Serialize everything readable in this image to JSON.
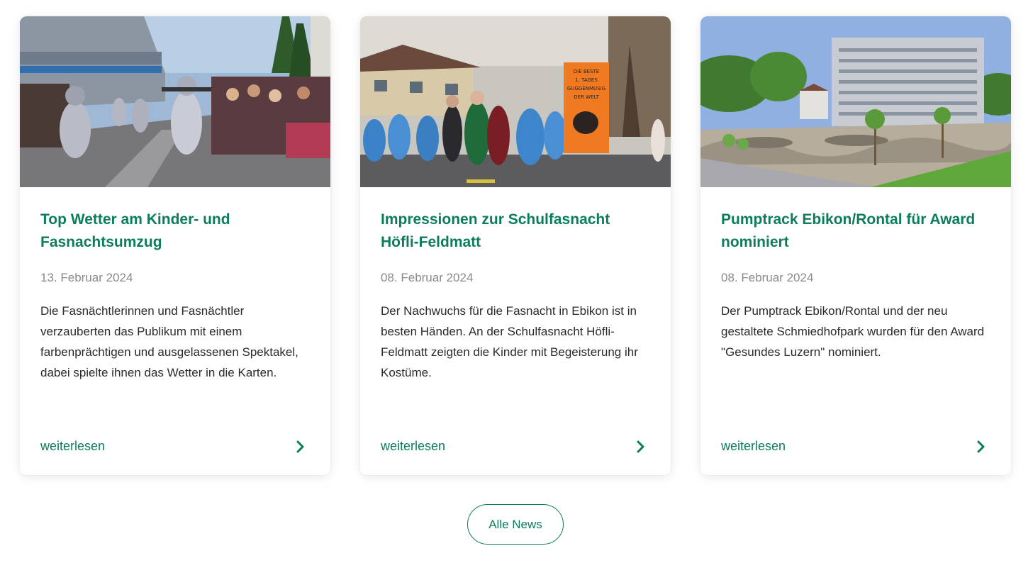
{
  "news": [
    {
      "title": "Top Wetter am Kinder- und Fasnachtsumzug",
      "date": "13. Februar 2024",
      "text": "Die Fasnächtlerinnen und Fasnächtler verzauberten das Publikum mit einem farbenprächtigen und ausgelassenen Spektakel, dabei spielte ihnen das Wetter in die Karten.",
      "link_label": "weiterlesen",
      "image": "carnival-parade-photo"
    },
    {
      "title": "Impressionen zur Schulfasnacht Höfli-Feldmatt",
      "date": "08. Februar 2024",
      "text": "Der Nachwuchs für die Fasnacht in Ebikon ist in besten Händen. An der Schulfasnacht Höfli-Feldmatt zeigten die Kinder mit Begeisterung ihr Kostüme.",
      "link_label": "weiterlesen",
      "image": "school-carnival-photo",
      "banner_lines": [
        "DIE BESTE",
        "1. TAGES",
        "GUGGENMUSIG",
        "DER WELT"
      ]
    },
    {
      "title": "Pumptrack Ebikon/Rontal für Award nominiert",
      "date": "08. Februar 2024",
      "text": "Der Pumptrack Ebikon/Rontal und der neu gestaltete Schmiedhofpark wurden für den Award \"Gesundes Luzern\" nominiert.",
      "link_label": "weiterlesen",
      "image": "pumptrack-park-photo"
    }
  ],
  "all_news_label": "Alle News",
  "colors": {
    "accent": "#0b7d5d",
    "date": "#8a8a8a",
    "text": "#2a2a2a"
  },
  "icons": {
    "link": "chevron-right-icon"
  }
}
